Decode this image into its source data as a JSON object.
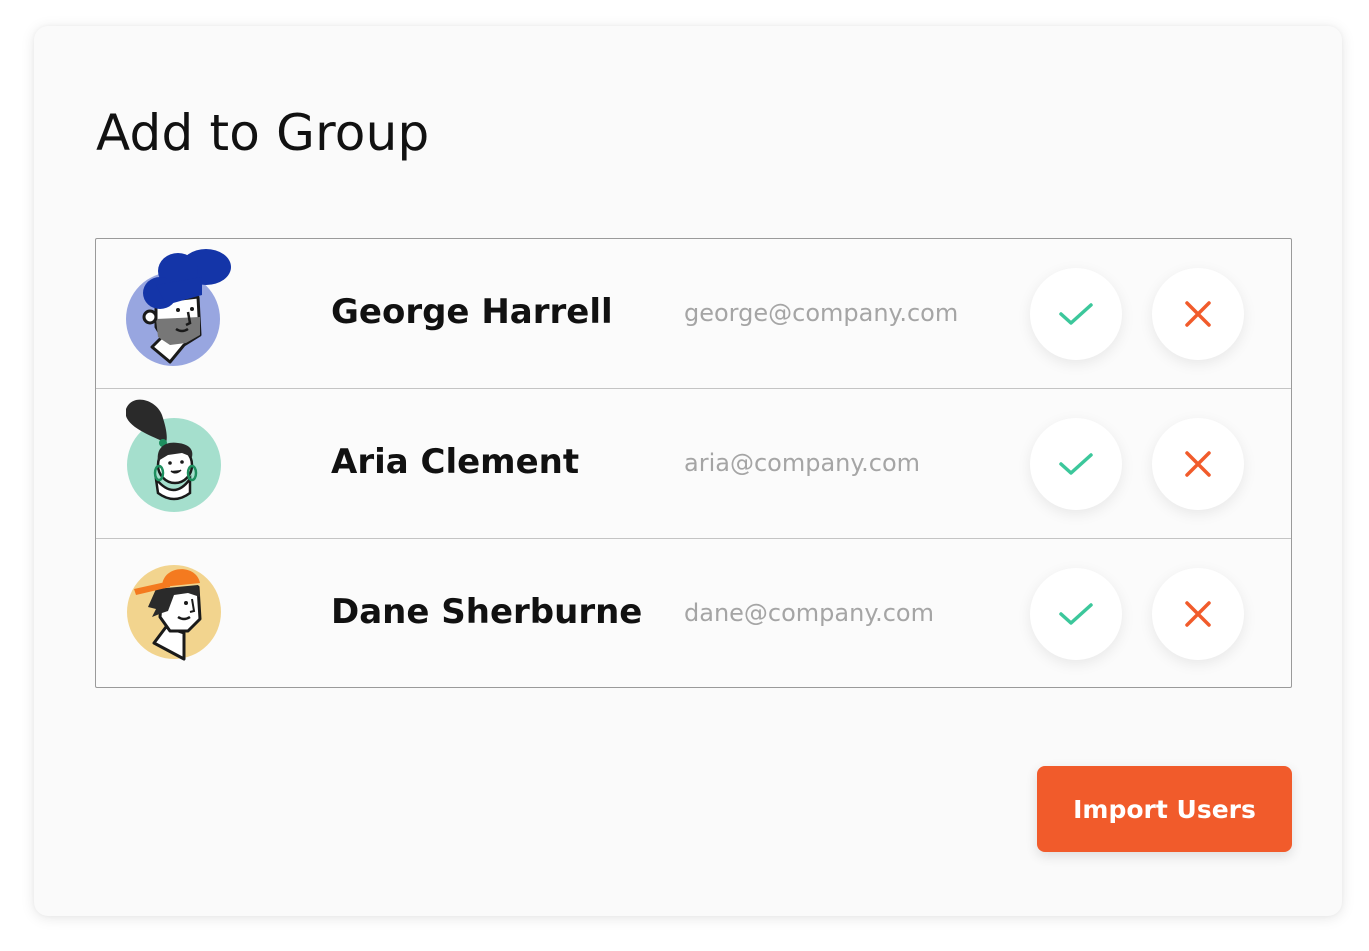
{
  "dialog": {
    "title": "Add to Group"
  },
  "users": [
    {
      "name": "George Harrell",
      "email": "george@company.com",
      "avatar": "avatar-george",
      "avatar_bg": "#98a6e0",
      "accent": "#1435a8"
    },
    {
      "name": "Aria Clement",
      "email": "aria@company.com",
      "avatar": "avatar-aria",
      "avatar_bg": "#a5dfcd",
      "accent": "#1e8f5f"
    },
    {
      "name": "Dane Sherburne",
      "email": "dane@company.com",
      "avatar": "avatar-dane",
      "avatar_bg": "#f2d48e",
      "accent": "#f47a1f"
    }
  ],
  "actions": {
    "accept_icon": "check-icon",
    "reject_icon": "close-icon",
    "accept_color": "#3cc79b",
    "reject_color": "#f15b2b"
  },
  "footer": {
    "import_label": "Import Users",
    "import_color": "#f15b2b"
  }
}
